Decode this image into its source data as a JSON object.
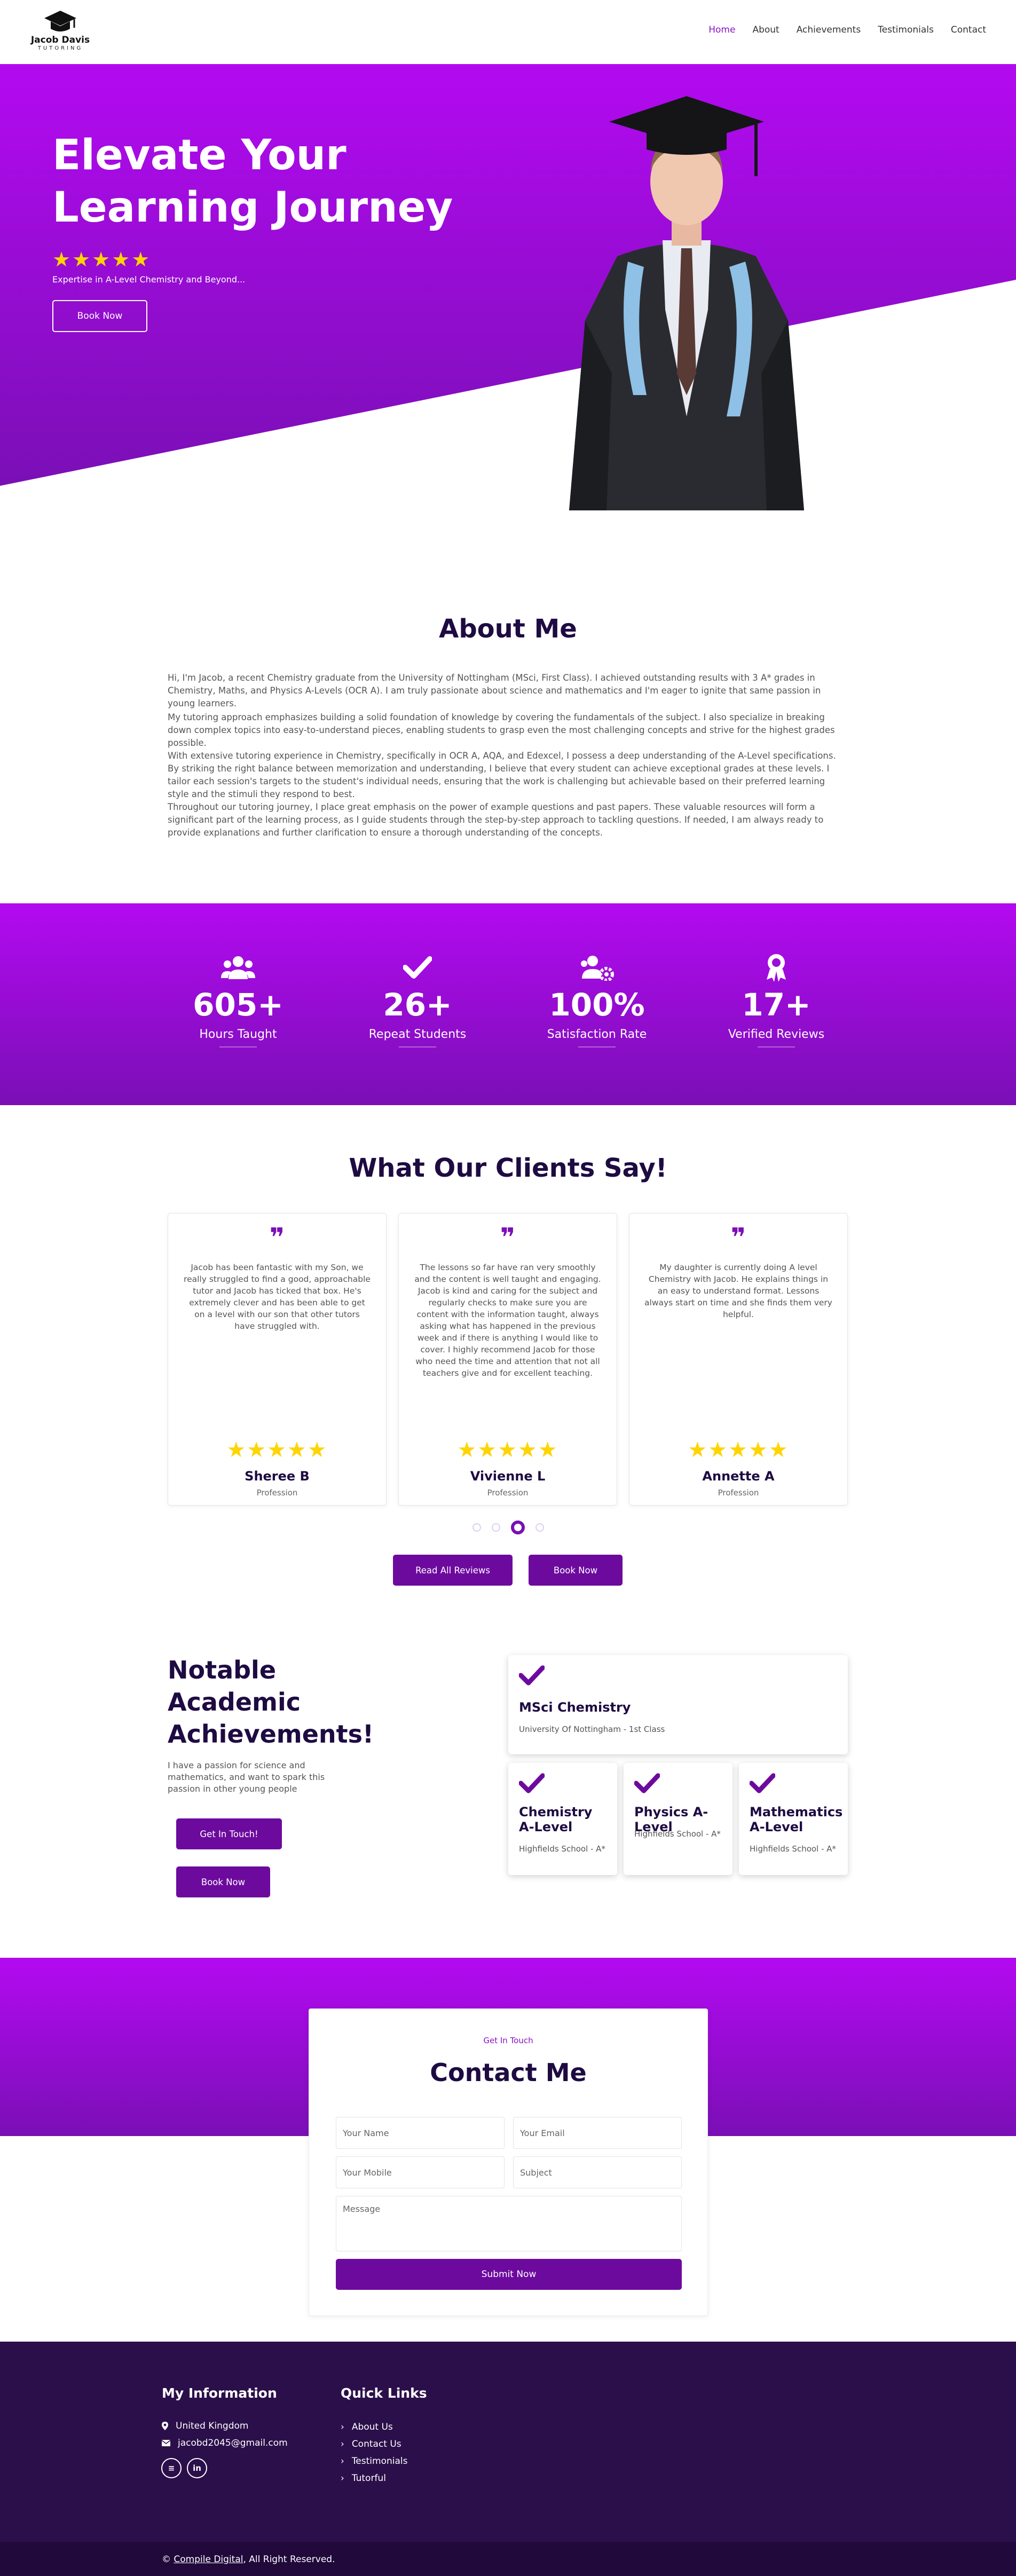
{
  "brand": {
    "name": "Jacob Davis",
    "tag": "TUTORING"
  },
  "nav": [
    "Home",
    "About",
    "Achievements",
    "Testimonials",
    "Contact"
  ],
  "hero": {
    "title": "Elevate Your Learning Journey",
    "stars": "★★★★★",
    "subtitle": "Expertise in A-Level Chemistry and Beyond...",
    "button": "Book Now"
  },
  "about": {
    "title": "About Me",
    "paragraphs": [
      "Hi, I'm Jacob, a recent Chemistry graduate from the University of Nottingham (MSci, First Class). I achieved outstanding results with 3 A* grades in Chemistry, Maths, and Physics A-Levels (OCR A). I am truly passionate about science and mathematics and I'm eager to ignite that same passion in young learners.",
      "My tutoring approach emphasizes building a solid foundation of knowledge by covering the fundamentals of the subject. I also specialize in breaking down complex topics into easy-to-understand pieces, enabling students to grasp even the most challenging concepts and strive for the highest grades possible.",
      "With extensive tutoring experience in Chemistry, specifically in OCR A, AQA, and Edexcel, I possess a deep understanding of the A-Level specifications. By striking the right balance between memorization and understanding, I believe that every student can achieve exceptional grades at these levels. I tailor each session's targets to the student's individual needs, ensuring that the work is challenging but achievable based on their preferred learning style and the stimuli they respond to best.",
      "Throughout our tutoring journey, I place great emphasis on the power of example questions and past papers. These valuable resources will form a significant part of the learning process, as I guide students through the step-by-step approach to tackling questions. If needed, I am always ready to provide explanations and further clarification to ensure a thorough understanding of the concepts."
    ]
  },
  "stats": [
    {
      "icon": "users-icon",
      "number": "605+",
      "label": "Hours Taught"
    },
    {
      "icon": "check-icon",
      "number": "26+",
      "label": "Repeat Students"
    },
    {
      "icon": "users-cog-icon",
      "number": "100%",
      "label": "Satisfaction Rate"
    },
    {
      "icon": "award-icon",
      "number": "17+",
      "label": "Verified Reviews"
    }
  ],
  "testimonials": {
    "title": "What Our Clients Say!",
    "quote_mark": "❞",
    "items": [
      {
        "text": "Jacob has been fantastic with my Son, we really struggled to find a good, approachable tutor and Jacob has ticked that box. He's extremely clever and has been able to get on a level with our son that other tutors have struggled with.",
        "stars": "★★★★★",
        "name": "Sheree B",
        "role": "Profession"
      },
      {
        "text": "The lessons so far have ran very smoothly and the content is well taught and engaging. Jacob is kind and caring for the subject and regularly checks to make sure you are content with the information taught, always asking what has happened in the previous week and if there is anything I would like to cover. I highly recommend Jacob for those who need the time and attention that not all teachers give and for excellent teaching.",
        "stars": "★★★★★",
        "name": "Vivienne L",
        "role": "Profession"
      },
      {
        "text": "My daughter is currently doing A level Chemistry with Jacob. He explains things in an easy to understand format. Lessons always start on time and she finds them very helpful.",
        "stars": "★★★★★",
        "name": "Annette A",
        "role": "Profession"
      }
    ],
    "read_all": "Read All Reviews",
    "book": "Book Now"
  },
  "achievements": {
    "title": "Notable Academic Achievements!",
    "desc": "I have a passion for science and mathematics, and want to spark this passion in other young people",
    "btn_touch": "Get In Touch!",
    "btn_book": "Book Now",
    "items": [
      {
        "title": "MSci Chemistry",
        "sub": "University Of Nottingham - 1st Class"
      },
      {
        "title": "Chemistry A-Level",
        "sub": "Highfields School - A*"
      },
      {
        "title": "Physics A-Level",
        "sub": "Highfields School - A*"
      },
      {
        "title": "Mathematics A-Level",
        "sub": "Highfields School - A*"
      }
    ]
  },
  "contact": {
    "eyebrow": "Get In Touch",
    "title": "Contact Me",
    "name_ph": "Your Name",
    "email_ph": "Your Email",
    "mobile_ph": "Your Mobile",
    "subject_ph": "Subject",
    "message_ph": "Message",
    "submit": "Submit Now"
  },
  "footer": {
    "info_title": "My Information",
    "location": "United Kingdom",
    "email": "jacobd2045@gmail.com",
    "links_title": "Quick Links",
    "links": [
      "About Us",
      "Contact Us",
      "Testimonials",
      "Tutorful"
    ],
    "copy_pre": "© ",
    "copy_link": "Compile Digital",
    "copy_post": ", All Right Reserved.",
    "social": [
      "tutorful-icon",
      "linkedin-icon"
    ]
  },
  "colors": {
    "primary": "#7a0fb6",
    "bright": "#b30af0",
    "dark": "#1e0b42",
    "footer": "#2b0f4a",
    "star": "#ffd400"
  }
}
